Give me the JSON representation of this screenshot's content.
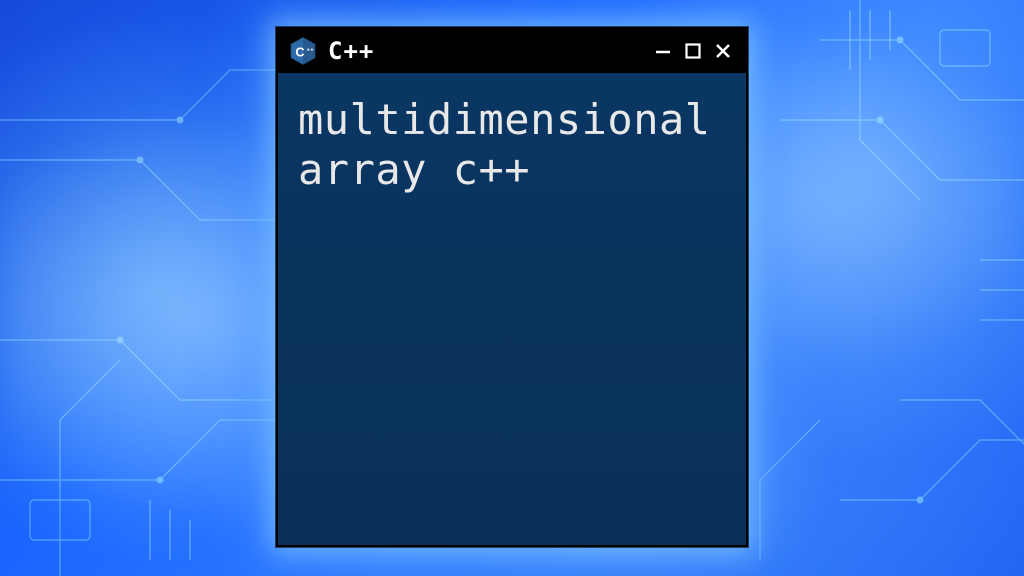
{
  "window": {
    "title": "C++",
    "logo_letter": "C",
    "logo_plus": "++"
  },
  "terminal": {
    "content": "multidimensional\narray c++"
  },
  "colors": {
    "window_bg": "#0a3663",
    "titlebar_bg": "#000000",
    "glow": "#6fb8ff",
    "logo_hex": "#2f6aa8"
  }
}
